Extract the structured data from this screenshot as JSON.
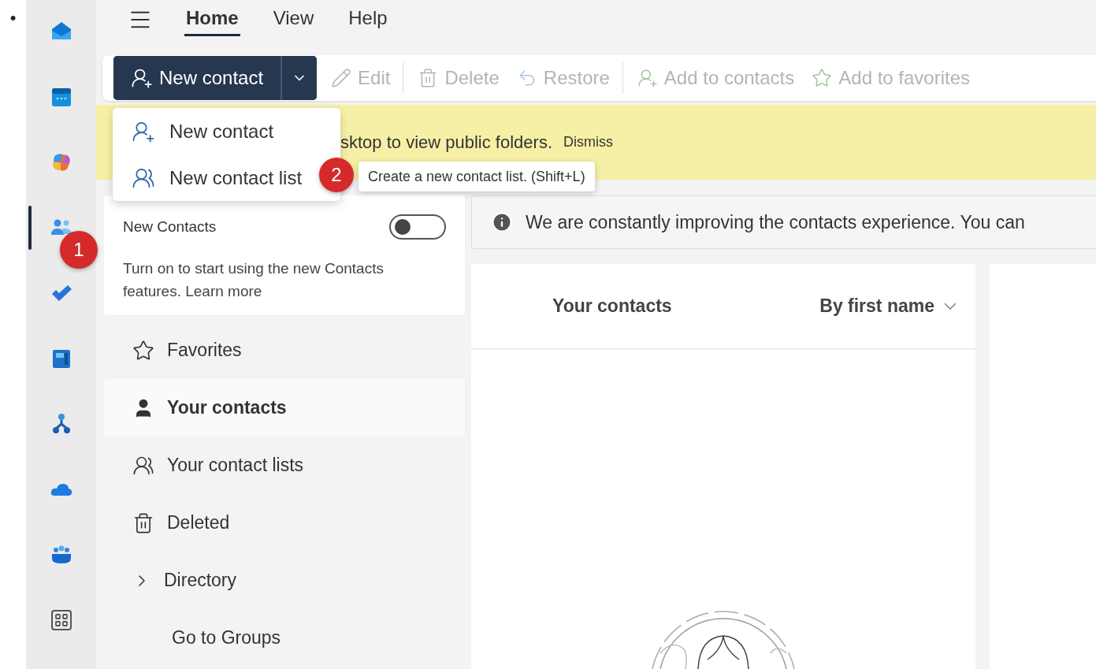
{
  "bullet": "•",
  "rail": [
    {
      "kind": "mail",
      "selected": false
    },
    {
      "kind": "calendar",
      "selected": false
    },
    {
      "kind": "copilot",
      "selected": false
    },
    {
      "kind": "people",
      "selected": true
    },
    {
      "kind": "todo",
      "selected": false
    },
    {
      "kind": "document",
      "selected": false
    },
    {
      "kind": "org",
      "selected": false
    },
    {
      "kind": "cloud",
      "selected": false
    },
    {
      "kind": "teams",
      "selected": false
    },
    {
      "kind": "apps",
      "selected": false
    }
  ],
  "menu_tabs": [
    {
      "label": "Home",
      "selected": true
    },
    {
      "label": "View",
      "selected": false
    },
    {
      "label": "Help",
      "selected": false
    }
  ],
  "toolbar": {
    "primary": "New contact",
    "groups": [
      {
        "actions": [
          {
            "kind": "edit",
            "label": "Edit",
            "disabled": true
          }
        ]
      },
      {
        "actions": [
          {
            "kind": "delete",
            "label": "Delete",
            "disabled": true
          },
          {
            "kind": "restore",
            "label": "Restore",
            "disabled": true
          }
        ]
      },
      {
        "actions": [
          {
            "kind": "add-contact",
            "label": "Add to contacts",
            "disabled": true
          },
          {
            "kind": "add-favorite",
            "label": "Add to favorites",
            "disabled": true
          }
        ]
      }
    ]
  },
  "dropdown": [
    {
      "kind": "contact",
      "label": "New contact"
    },
    {
      "kind": "list",
      "label": "New contact list"
    }
  ],
  "tooltip": "Create a new contact list. (Shift+L)",
  "step_badges": [
    {
      "label": "1"
    },
    {
      "label": "2"
    }
  ],
  "banner": {
    "text": "sktop to view public folders.",
    "action": "Dismiss"
  },
  "new_contacts_card": {
    "title": "New Contacts",
    "on": false,
    "description": "Turn on to start using the new Contacts features.",
    "link": "Learn more"
  },
  "nav": [
    {
      "kind": "favorites",
      "label": "Favorites",
      "selected": false
    },
    {
      "kind": "contacts",
      "label": "Your contacts",
      "selected": true
    },
    {
      "kind": "lists",
      "label": "Your contact lists",
      "selected": false
    },
    {
      "kind": "deleted",
      "label": "Deleted",
      "selected": false
    },
    {
      "kind": "directory",
      "label": "Directory",
      "selected": false,
      "expanded": false
    },
    {
      "kind": "link",
      "label": "Go to Groups",
      "selected": false
    }
  ],
  "info": "We are constantly improving the contacts experience. You can",
  "contacts_pane": {
    "title": "Your contacts",
    "sort": "By first name"
  }
}
